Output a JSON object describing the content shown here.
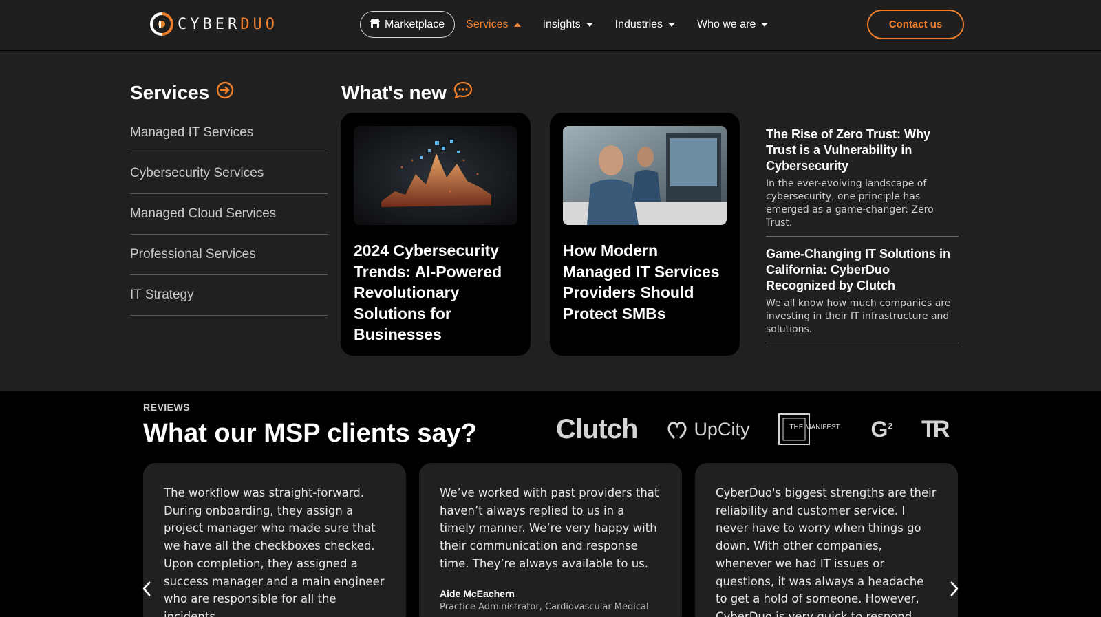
{
  "header": {
    "logo": {
      "text_white": "CYBER",
      "text_orange": "DUO"
    },
    "nav": {
      "marketplace": "Marketplace",
      "items": [
        {
          "label": "Services",
          "active": true
        },
        {
          "label": "Insights",
          "active": false
        },
        {
          "label": "Industries",
          "active": false
        },
        {
          "label": "Who we are",
          "active": false
        }
      ]
    },
    "contact": "Contact us"
  },
  "mega_menu": {
    "services_title": "Services",
    "services": [
      "Managed IT Services",
      "Cybersecurity Services",
      "Managed Cloud Services",
      "Professional Services",
      "IT Strategy"
    ],
    "whats_new_title": "What's new",
    "cards": [
      {
        "title": "2024 Cybersecurity Trends: AI-Powered Revolutionary Solutions for Businesses",
        "image": "ai-chart-illustration"
      },
      {
        "title": "How Modern Managed IT Services Providers Should Protect SMBs",
        "image": "office-workers-photo"
      }
    ],
    "news": [
      {
        "title": "The Rise of Zero Trust: Why Trust is a Vulnerability in Cybersecurity",
        "desc": "In the ever-evolving landscape of cybersecurity, one principle has emerged as a game-changer: Zero Trust."
      },
      {
        "title": "Game-Changing IT Solutions in California: CyberDuo Recognized by Clutch",
        "desc": "We all know how much companies are investing in their IT infrastructure and solutions."
      }
    ]
  },
  "reviews": {
    "label": "REVIEWS",
    "title": "What our MSP clients say?",
    "brands": {
      "clutch": "Clutch",
      "upcity": "UpCity",
      "manifest": "THE MANIFEST",
      "g2": "G",
      "tr": "TR"
    },
    "items": [
      {
        "quote": "The workflow was straight-forward. During onboarding, they assign a project manager who made sure that we have all the checkboxes checked. Upon completion, they assigned a success manager and a main engineer who are responsible for all the incidents.",
        "author": "",
        "role": ""
      },
      {
        "quote": "We’ve worked with past providers that haven’t always replied to us in a timely manner. We’re very happy with their communication and response time. They’re always available to us.",
        "author": "Aide McEachern",
        "role": "Practice Administrator, Cardiovascular Medical"
      },
      {
        "quote": "CyberDuo's biggest strengths are their reliability and customer service. I never have to worry when things go down. With other companies, whenever we had IT issues or questions, it was always a headache to get a hold of someone. However, CyberDuo is very quick to respond.",
        "author": "",
        "role": ""
      }
    ]
  },
  "colors": {
    "accent": "#f07f2c",
    "header_bg": "#1f1f1f",
    "menu_bg": "#202020",
    "card_bg": "#000000"
  }
}
